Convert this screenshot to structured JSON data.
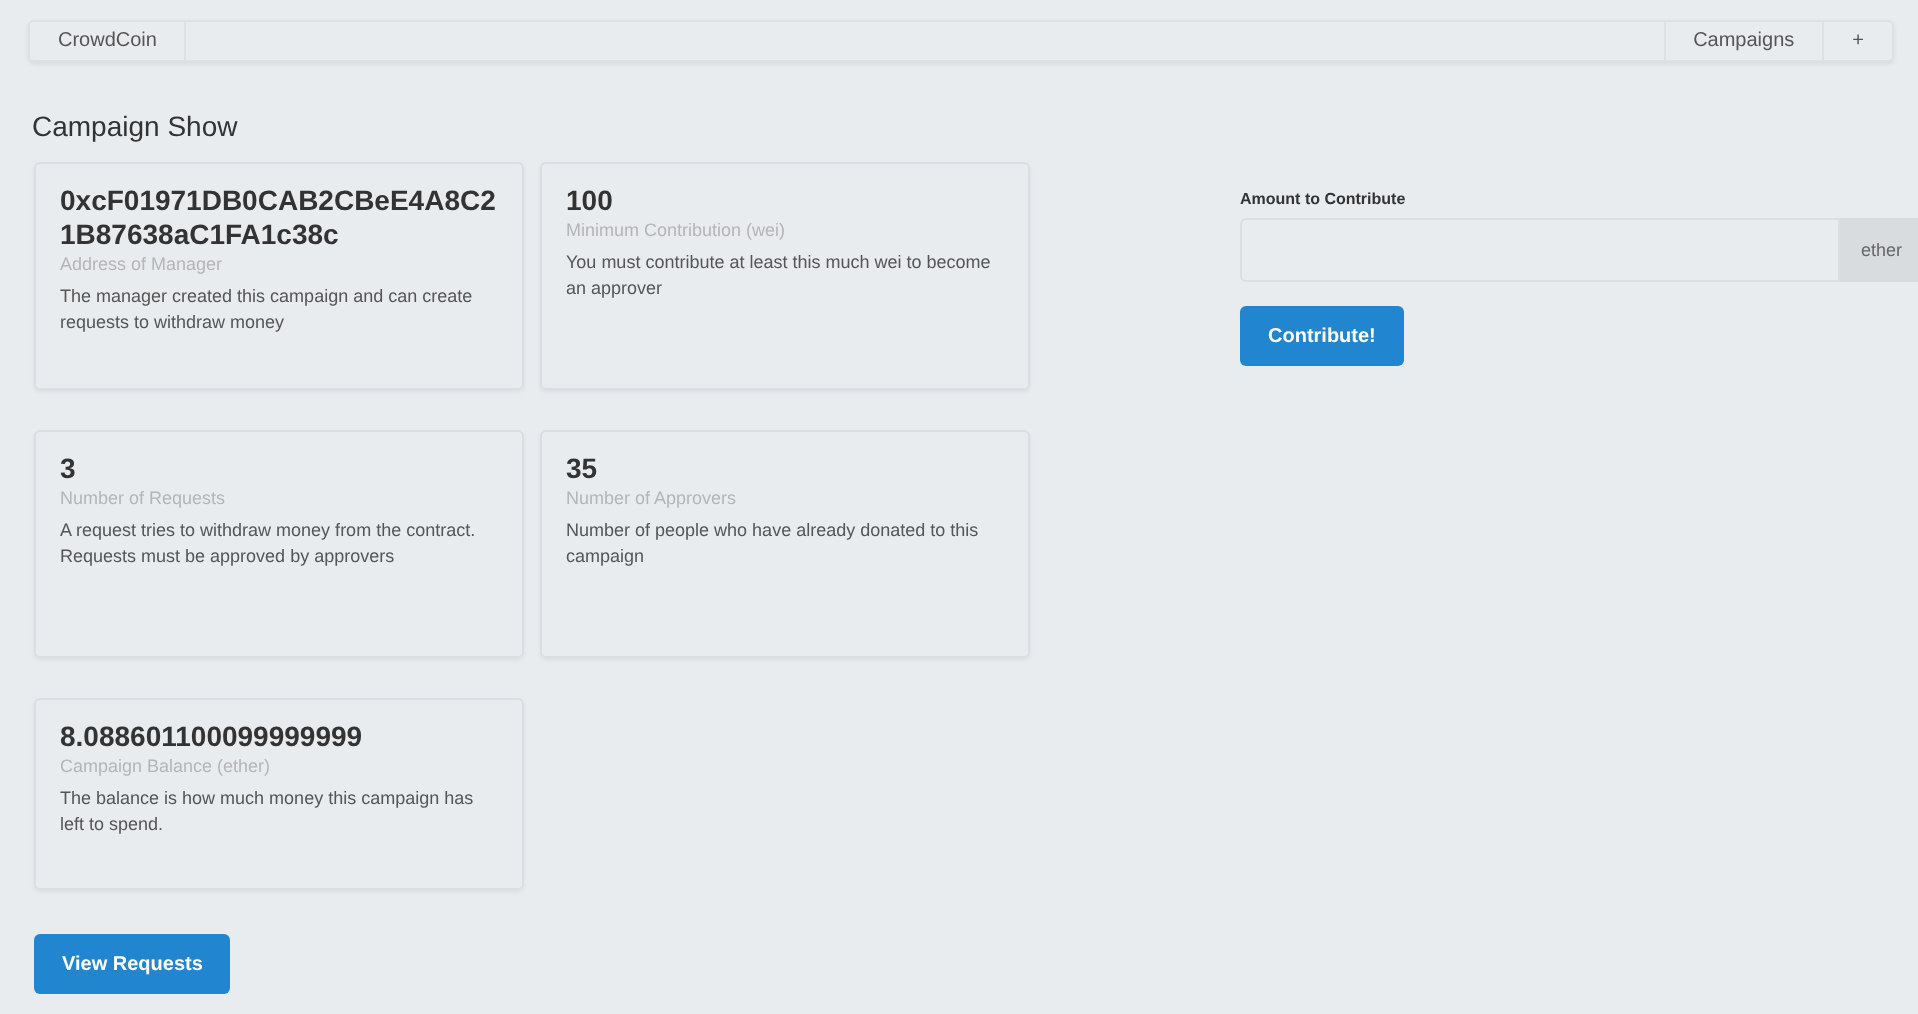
{
  "menu": {
    "brand": "CrowdCoin",
    "items": [
      "Campaigns",
      "+"
    ]
  },
  "heading": "Campaign Show",
  "cards": [
    {
      "header": "0xcF01971DB0CAB2CBeE4A8C21B87638aC1FA1c38c",
      "meta": "Address of Manager",
      "description": "The manager created this campaign and can create requests to withdraw money"
    },
    {
      "header": "100",
      "meta": "Minimum Contribution (wei)",
      "description": "You must contribute at least this much wei to become an approver"
    },
    {
      "header": "3",
      "meta": "Number of Requests",
      "description": "A request tries to withdraw money from the contract. Requests must be approved by approvers"
    },
    {
      "header": "35",
      "meta": "Number of Approvers",
      "description": "Number of people who have already donated to this campaign"
    },
    {
      "header": "8.088601100099999999",
      "meta": "Campaign Balance (ether)",
      "description": "The balance is how much money this campaign has left to spend."
    }
  ],
  "view_requests_button": "View Requests",
  "contribute_form": {
    "label": "Amount to Contribute",
    "unit": "ether",
    "button": "Contribute!"
  }
}
